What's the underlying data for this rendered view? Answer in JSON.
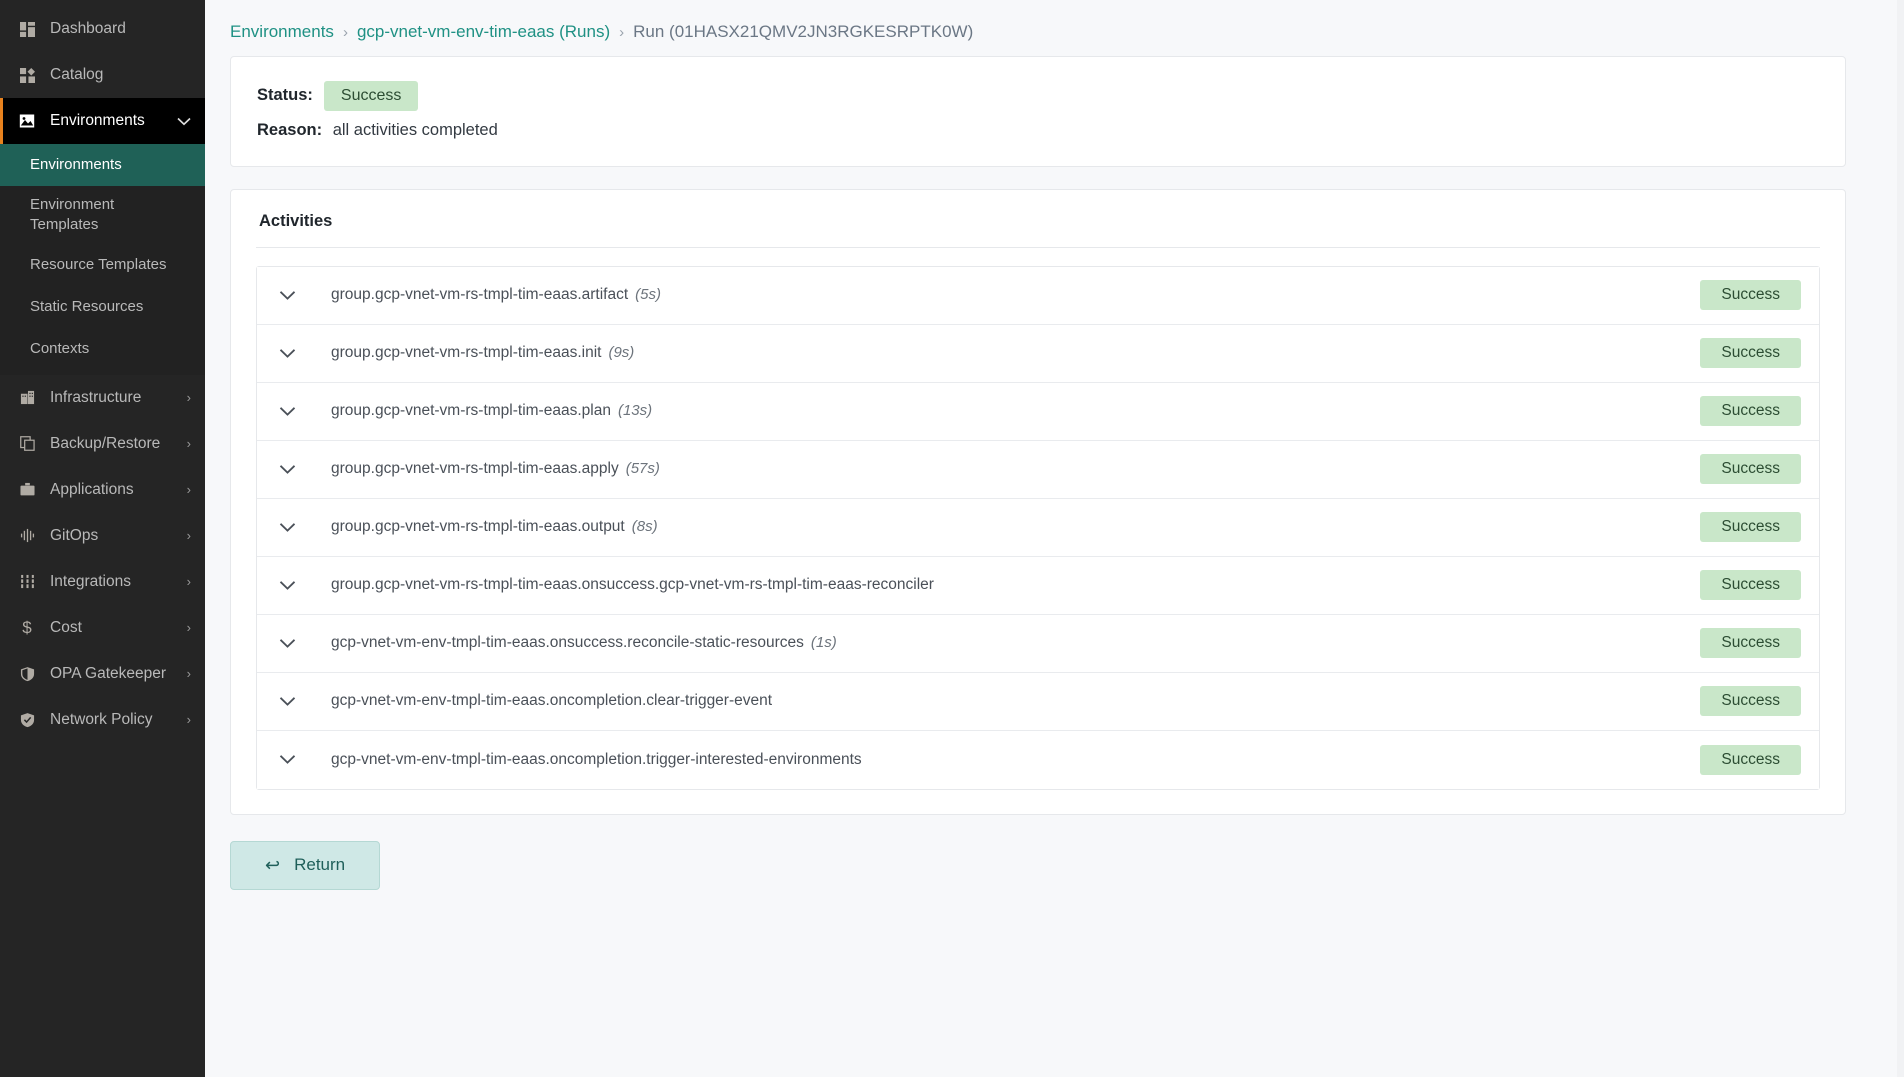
{
  "sidebar": {
    "items": [
      {
        "label": "Dashboard",
        "icon": "dashboard-icon",
        "has_chevron": false,
        "state": "normal"
      },
      {
        "label": "Catalog",
        "icon": "catalog-icon",
        "has_chevron": false,
        "state": "normal"
      },
      {
        "label": "Environments",
        "icon": "environments-icon",
        "has_chevron": true,
        "chevron": "⌄",
        "state": "expanded"
      }
    ],
    "sub_items": [
      {
        "label": "Environments",
        "selected": true
      },
      {
        "label": "Environment Templates",
        "selected": false
      },
      {
        "label": "Resource Templates",
        "selected": false
      },
      {
        "label": "Static Resources",
        "selected": false
      },
      {
        "label": "Contexts",
        "selected": false
      }
    ],
    "items_lower": [
      {
        "label": "Infrastructure",
        "icon": "building-icon",
        "chevron": "›"
      },
      {
        "label": "Backup/Restore",
        "icon": "copy-icon",
        "chevron": "›"
      },
      {
        "label": "Applications",
        "icon": "briefcase-icon",
        "chevron": "›"
      },
      {
        "label": "GitOps",
        "icon": "pulse-icon",
        "chevron": "›"
      },
      {
        "label": "Integrations",
        "icon": "sliders-icon",
        "chevron": "›"
      },
      {
        "label": "Cost",
        "icon": "dollar-icon",
        "chevron": "›"
      },
      {
        "label": "OPA Gatekeeper",
        "icon": "shield-icon",
        "chevron": "›"
      },
      {
        "label": "Network Policy",
        "icon": "shield-check-icon",
        "chevron": "›"
      }
    ],
    "accent_color": "#e8821e",
    "selected_color": "#1f6157"
  },
  "breadcrumb": {
    "root": "Environments",
    "sep": "›",
    "env": "gcp-vnet-vm-env-tim-eaas (Runs)",
    "current": "Run (01HASX21QMV2JN3RGKESRPTK0W)"
  },
  "status_card": {
    "status_label": "Status:",
    "status_value": "Success",
    "reason_label": "Reason:",
    "reason_value": "all activities completed",
    "badge_color": "#c9e7c9"
  },
  "activities": {
    "title": "Activities",
    "chevron": "⌄",
    "rows": [
      {
        "name": "group.gcp-vnet-vm-rs-tmpl-tim-eaas.artifact",
        "duration": "(5s)",
        "status": "Success"
      },
      {
        "name": "group.gcp-vnet-vm-rs-tmpl-tim-eaas.init",
        "duration": "(9s)",
        "status": "Success"
      },
      {
        "name": "group.gcp-vnet-vm-rs-tmpl-tim-eaas.plan",
        "duration": "(13s)",
        "status": "Success"
      },
      {
        "name": "group.gcp-vnet-vm-rs-tmpl-tim-eaas.apply",
        "duration": "(57s)",
        "status": "Success"
      },
      {
        "name": "group.gcp-vnet-vm-rs-tmpl-tim-eaas.output",
        "duration": "(8s)",
        "status": "Success"
      },
      {
        "name": "group.gcp-vnet-vm-rs-tmpl-tim-eaas.onsuccess.gcp-vnet-vm-rs-tmpl-tim-eaas-reconciler",
        "duration": "",
        "status": "Success"
      },
      {
        "name": "gcp-vnet-vm-env-tmpl-tim-eaas.onsuccess.reconcile-static-resources",
        "duration": "(1s)",
        "status": "Success"
      },
      {
        "name": "gcp-vnet-vm-env-tmpl-tim-eaas.oncompletion.clear-trigger-event",
        "duration": "",
        "status": "Success"
      },
      {
        "name": "gcp-vnet-vm-env-tmpl-tim-eaas.oncompletion.trigger-interested-environments",
        "duration": "",
        "status": "Success"
      }
    ]
  },
  "footer": {
    "return_label": "Return",
    "return_arrow": "↩"
  }
}
